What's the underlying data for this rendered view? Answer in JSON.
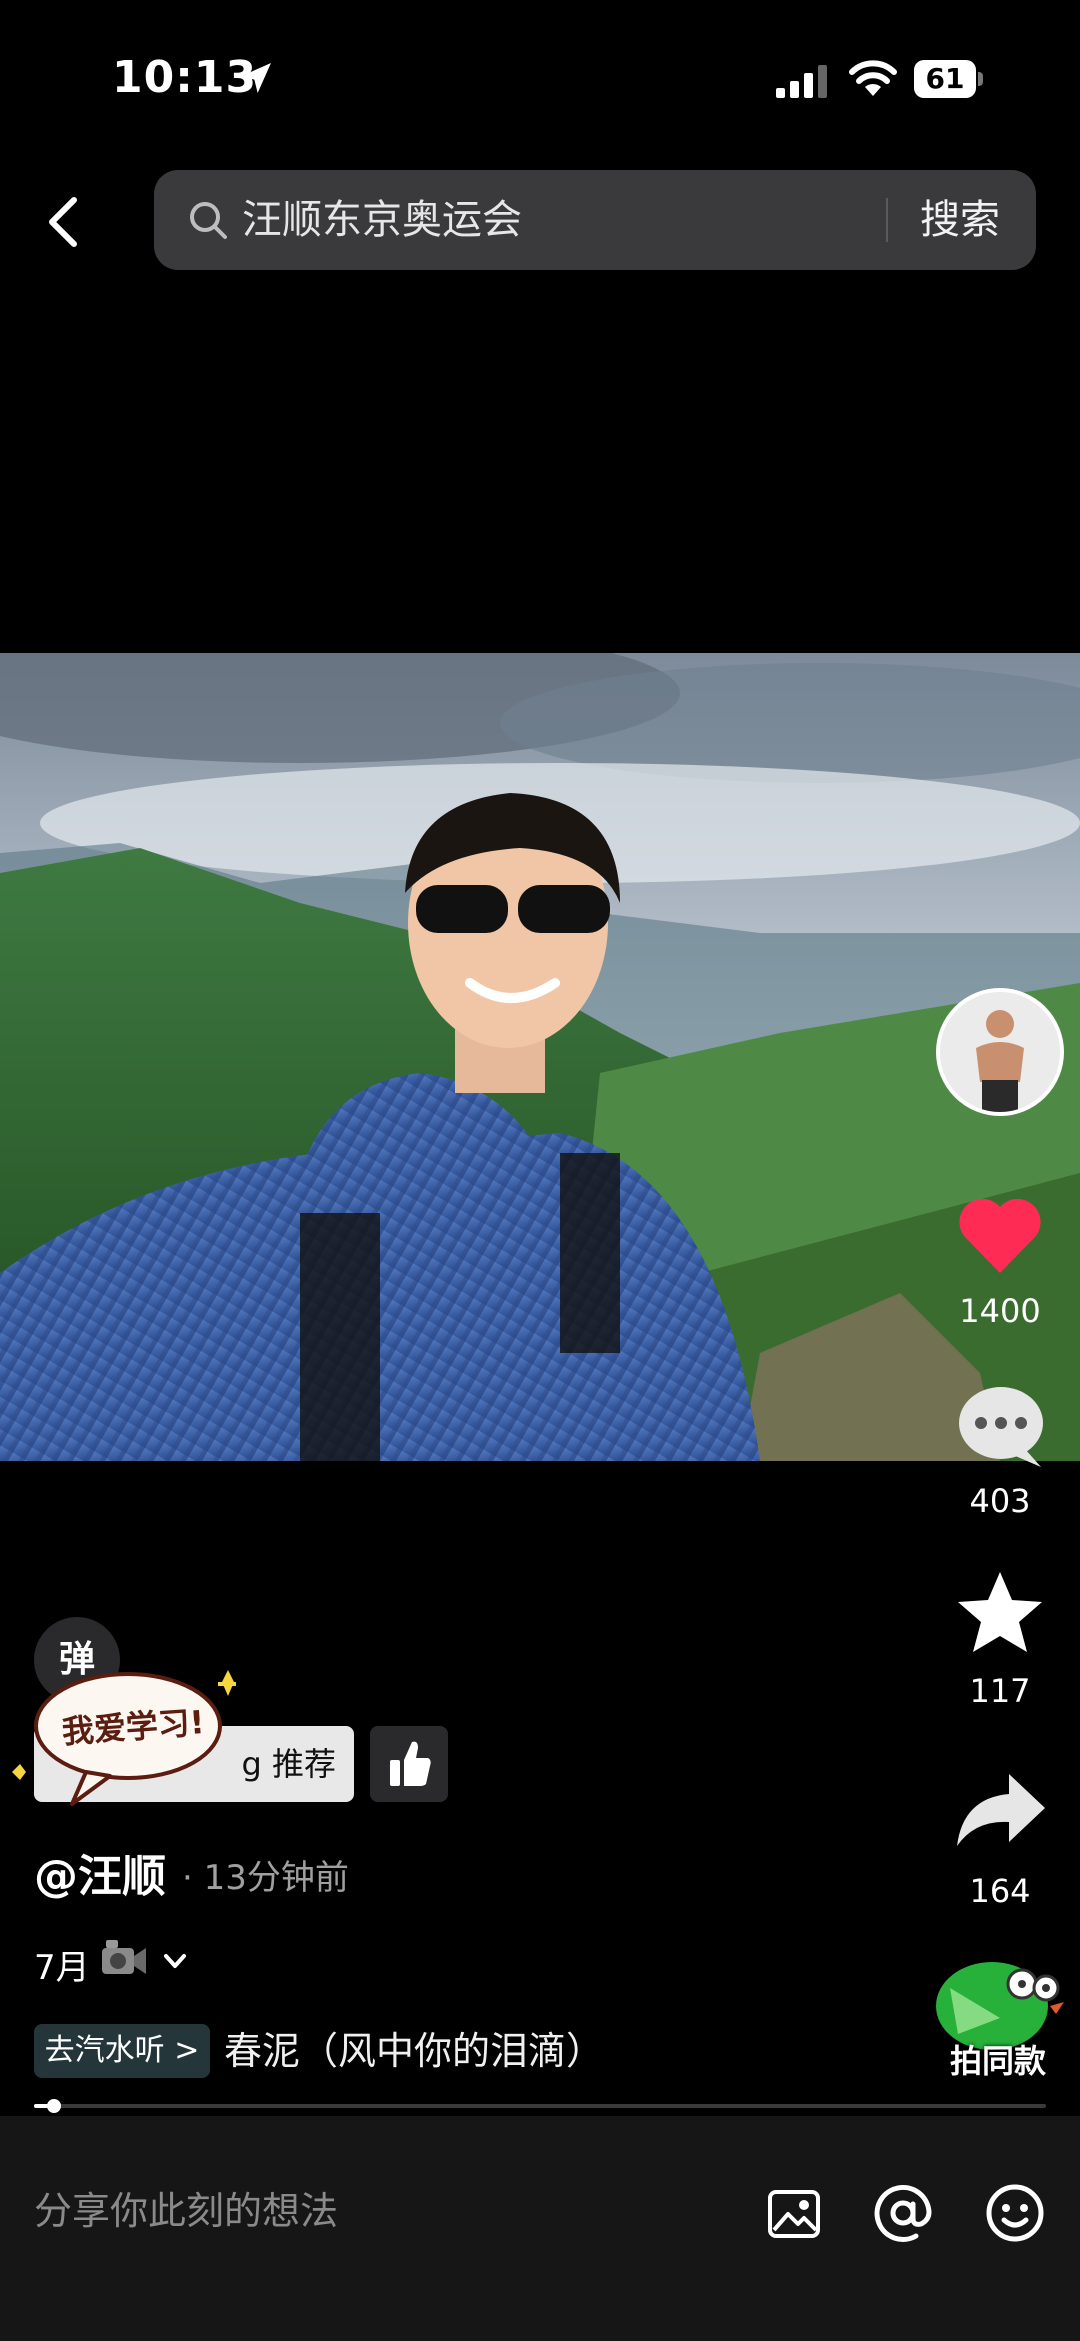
{
  "status_bar": {
    "time": "10:13",
    "battery": "61"
  },
  "search": {
    "query": "汪顺东京奥运会",
    "button_label": "搜索"
  },
  "actions": {
    "like_count": "1400",
    "comment_count": "403",
    "favorite_count": "117",
    "share_count": "164",
    "same_style_label": "拍同款"
  },
  "overlay": {
    "danmaku_label": "弹",
    "recommend_text": "g 推荐",
    "sticker_text": "我爱学习!"
  },
  "post": {
    "author": "@汪顺",
    "time": "· 13分钟前",
    "caption": "7月"
  },
  "music": {
    "tag_label": "去汽水听 >",
    "title": "春泥（风中你的泪滴）"
  },
  "playback": {
    "progress": 0.02
  },
  "comment_bar": {
    "placeholder": "分享你此刻的想法"
  },
  "colors": {
    "like": "#fe2c55",
    "background": "#000000",
    "bar": "#161616"
  }
}
